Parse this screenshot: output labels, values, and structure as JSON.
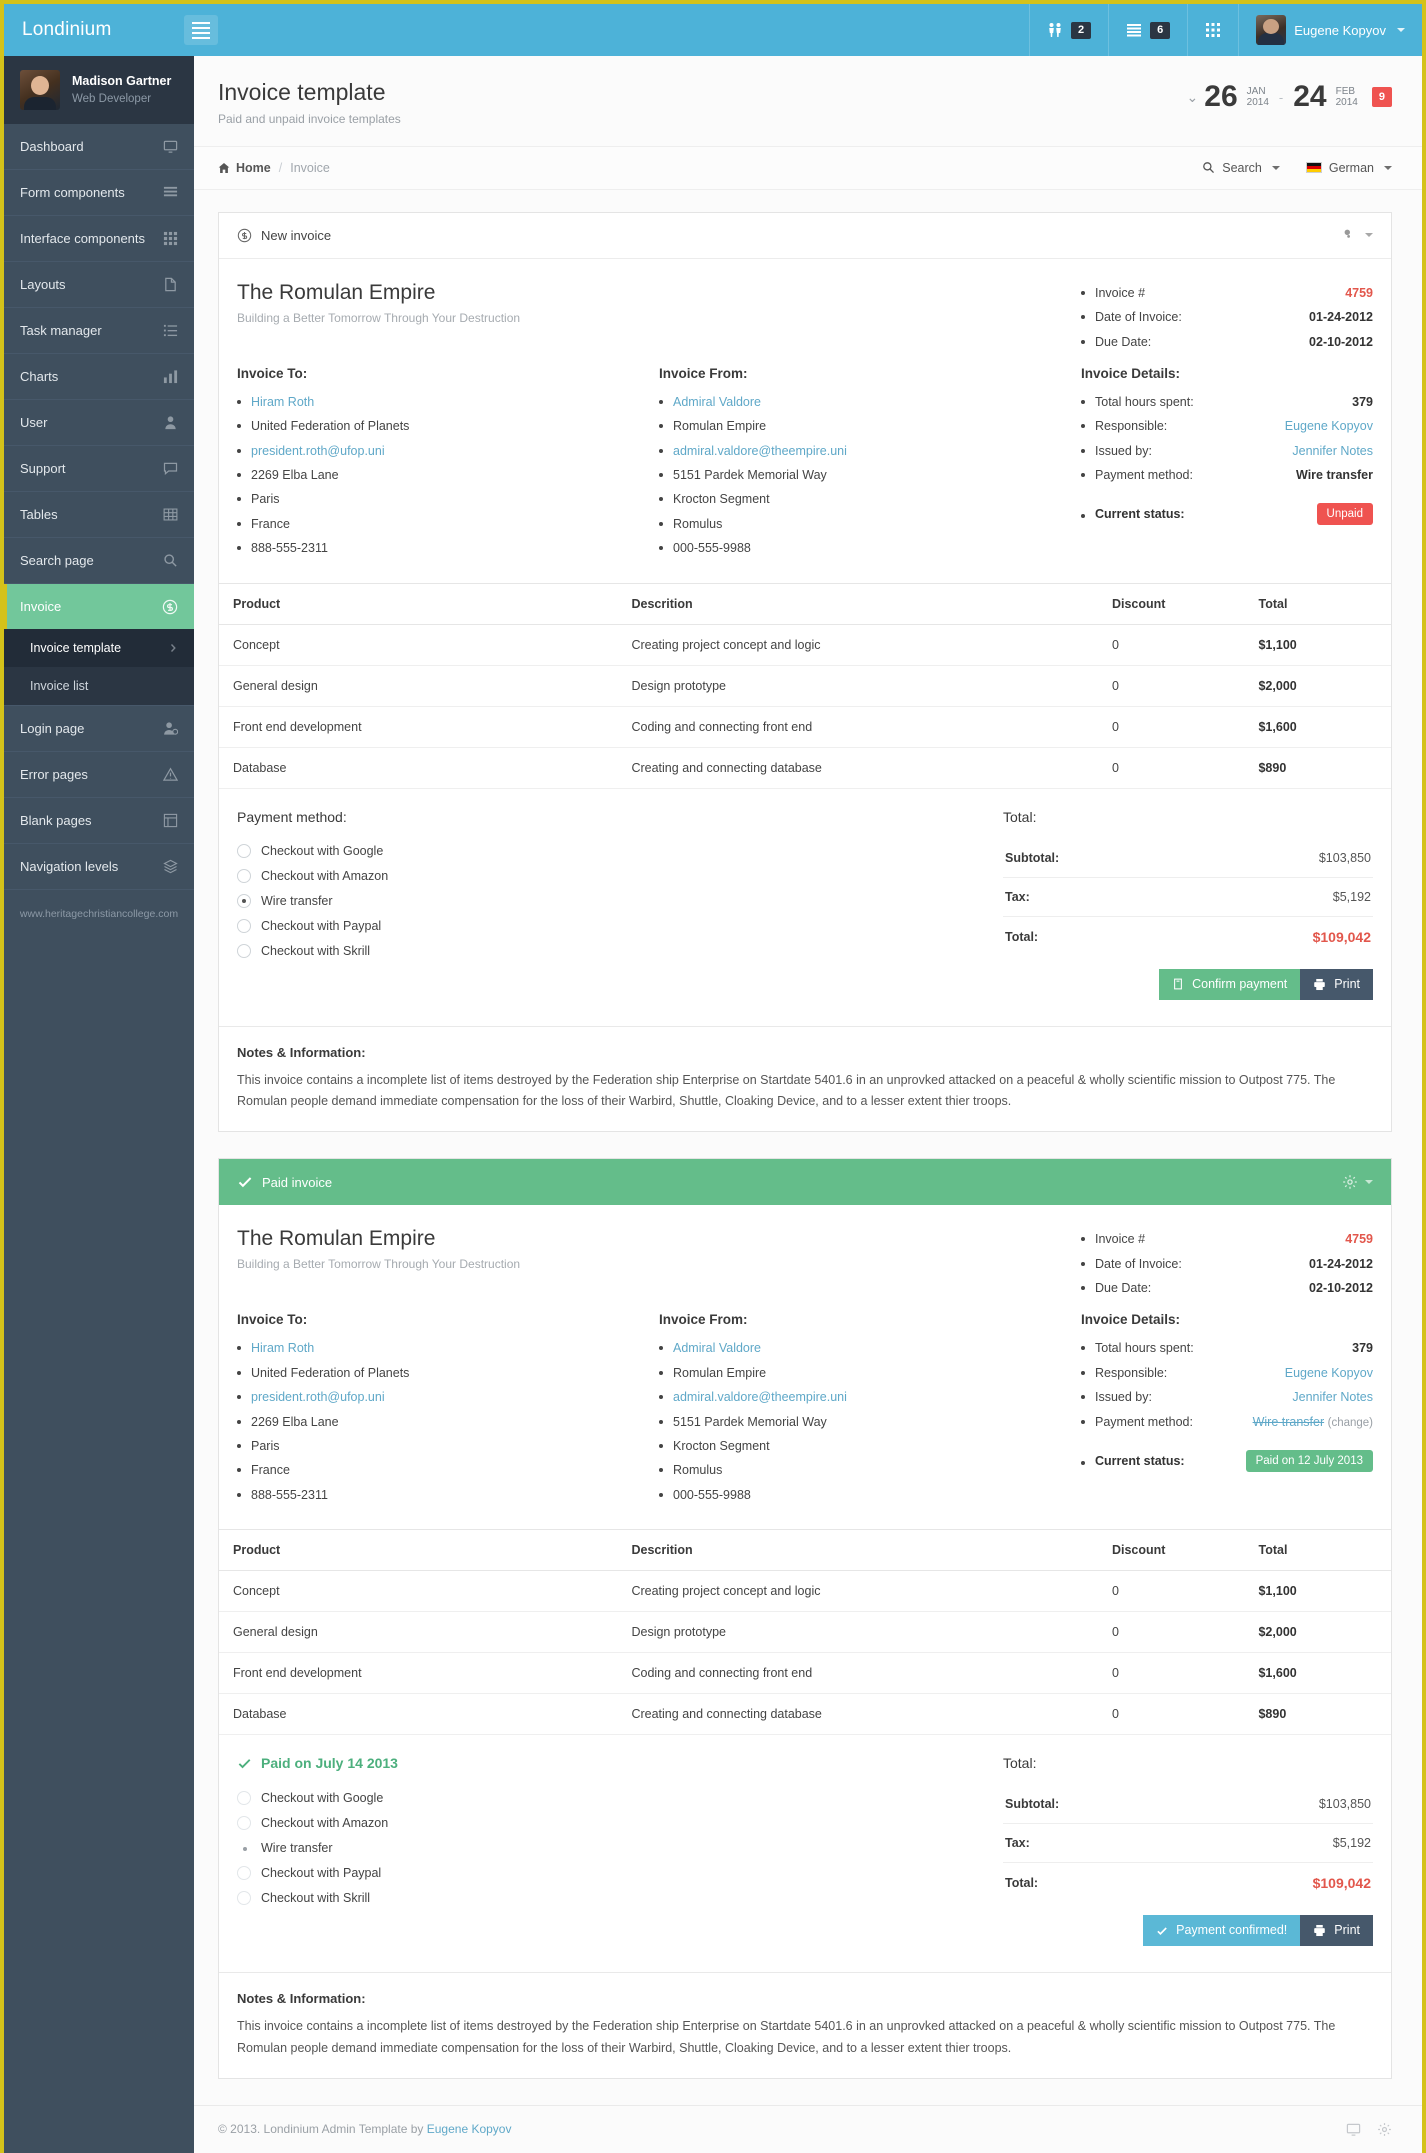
{
  "navbar": {
    "brand": "Londinium",
    "toggle_icon": "hamburger-icon",
    "items": [
      {
        "icon": "users-icon",
        "badge": "2"
      },
      {
        "icon": "lines-icon",
        "badge": "6"
      },
      {
        "icon": "grid-icon",
        "badge": ""
      }
    ],
    "user": "Eugene Kopyov"
  },
  "sidebar": {
    "profile": {
      "name": "Madison Gartner",
      "role": "Web Developer"
    },
    "items": [
      {
        "label": "Dashboard",
        "icon": "monitor-icon"
      },
      {
        "label": "Form components",
        "icon": "list-icon"
      },
      {
        "label": "Interface components",
        "icon": "grid-icon"
      },
      {
        "label": "Layouts",
        "icon": "page-icon"
      },
      {
        "label": "Task manager",
        "icon": "tasks-icon"
      },
      {
        "label": "Charts",
        "icon": "bars-icon"
      },
      {
        "label": "User",
        "icon": "user-icon"
      },
      {
        "label": "Support",
        "icon": "chat-icon"
      },
      {
        "label": "Tables",
        "icon": "table-icon"
      },
      {
        "label": "Search page",
        "icon": "search-icon"
      },
      {
        "label": "Invoice",
        "icon": "dollar-icon"
      },
      {
        "label": "Login page",
        "icon": "login-icon"
      },
      {
        "label": "Error pages",
        "icon": "warning-icon"
      },
      {
        "label": "Blank pages",
        "icon": "blank-icon"
      },
      {
        "label": "Navigation levels",
        "icon": "layers-icon"
      }
    ],
    "submenu": [
      {
        "label": "Invoice template",
        "selected": true
      },
      {
        "label": "Invoice list",
        "selected": false
      }
    ],
    "site_url": "www.heritagechristiancollege.com"
  },
  "page": {
    "title": "Invoice template",
    "subtitle": "Paid and unpaid invoice templates",
    "daterange": {
      "from_day": "26",
      "from_month": "JAN",
      "from_year": "2014",
      "to_day": "24",
      "to_month": "FEB",
      "to_year": "2014",
      "badge": "9"
    }
  },
  "breadcrumb": {
    "home": "Home",
    "separator": "/",
    "current": "Invoice",
    "search_label": "Search",
    "language_label": "German"
  },
  "invoice_unpaid": {
    "panel_title": "New invoice",
    "panel_icon": "dollar-circle-icon",
    "company": "The Romulan Empire",
    "tagline": "Building a Better Tomorrow Through Your Destruction",
    "header_meta": [
      {
        "label": "Invoice #",
        "value": "4759",
        "style": "red"
      },
      {
        "label": "Date of Invoice:",
        "value": "01-24-2012",
        "style": "bold"
      },
      {
        "label": "Due Date:",
        "value": "02-10-2012",
        "style": "bold"
      }
    ],
    "invoice_to_title": "Invoice To:",
    "invoice_to": [
      {
        "text": "Hiram Roth",
        "link": true
      },
      {
        "text": "United Federation of Planets",
        "link": false
      },
      {
        "text": "president.roth@ufop.uni",
        "link": true
      },
      {
        "text": "2269 Elba Lane",
        "link": false
      },
      {
        "text": "Paris",
        "link": false
      },
      {
        "text": "France",
        "link": false
      },
      {
        "text": "888-555-2311",
        "link": false
      }
    ],
    "invoice_from_title": "Invoice From:",
    "invoice_from": [
      {
        "text": "Admiral Valdore",
        "link": true
      },
      {
        "text": "Romulan Empire",
        "link": false
      },
      {
        "text": "admiral.valdore@theempire.uni",
        "link": true
      },
      {
        "text": "5151 Pardek Memorial Way",
        "link": false
      },
      {
        "text": "Krocton Segment",
        "link": false
      },
      {
        "text": "Romulus",
        "link": false
      },
      {
        "text": "000-555-9988",
        "link": false
      }
    ],
    "details_title": "Invoice Details:",
    "details": [
      {
        "label": "Total hours spent:",
        "value": "379",
        "style": "plain"
      },
      {
        "label": "Responsible:",
        "value": "Eugene Kopyov",
        "style": "link"
      },
      {
        "label": "Issued by:",
        "value": "Jennifer Notes",
        "style": "link"
      },
      {
        "label": "Payment method:",
        "value": "Wire transfer",
        "style": "plain"
      }
    ],
    "status_label": "Current status:",
    "status_value": "Unpaid",
    "table": {
      "headers": [
        "Product",
        "Descrition",
        "Discount",
        "Total"
      ],
      "rows": [
        [
          "Concept",
          "Creating project concept and logic",
          "0",
          "$1,100"
        ],
        [
          "General design",
          "Design prototype",
          "0",
          "$2,000"
        ],
        [
          "Front end development",
          "Coding and connecting front end",
          "0",
          "$1,600"
        ],
        [
          "Database",
          "Creating and connecting database",
          "0",
          "$890"
        ]
      ]
    },
    "payment_title": "Payment method:",
    "payment_options": [
      {
        "label": "Checkout with Google",
        "selected": false
      },
      {
        "label": "Checkout with Amazon",
        "selected": false
      },
      {
        "label": "Wire transfer",
        "selected": true
      },
      {
        "label": "Checkout with Paypal",
        "selected": false
      },
      {
        "label": "Checkout with Skrill",
        "selected": false
      }
    ],
    "totals_title": "Total:",
    "totals": [
      {
        "label": "Subtotal:",
        "value": "$103,850",
        "grand": false
      },
      {
        "label": "Tax:",
        "value": "$5,192",
        "grand": false
      },
      {
        "label": "Total:",
        "value": "$109,042",
        "grand": true
      }
    ],
    "confirm_button": "Confirm payment",
    "print_button": "Print",
    "notes_title": "Notes & Information:",
    "notes_body": "This invoice contains a incomplete list of items destroyed by the Federation ship Enterprise on Startdate 5401.6 in an unprovked attacked on a peaceful & wholly scientific mission to Outpost 775. The Romulan people demand immediate compensation for the loss of their Warbird, Shuttle, Cloaking Device, and to a lesser extent thier troops."
  },
  "invoice_paid": {
    "panel_title": "Paid invoice",
    "panel_icon": "check-icon",
    "company": "The Romulan Empire",
    "tagline": "Building a Better Tomorrow Through Your Destruction",
    "header_meta": [
      {
        "label": "Invoice #",
        "value": "4759",
        "style": "red"
      },
      {
        "label": "Date of Invoice:",
        "value": "01-24-2012",
        "style": "bold"
      },
      {
        "label": "Due Date:",
        "value": "02-10-2012",
        "style": "bold"
      }
    ],
    "invoice_to_title": "Invoice To:",
    "invoice_to": [
      {
        "text": "Hiram Roth",
        "link": true
      },
      {
        "text": "United Federation of Planets",
        "link": false
      },
      {
        "text": "president.roth@ufop.uni",
        "link": true
      },
      {
        "text": "2269 Elba Lane",
        "link": false
      },
      {
        "text": "Paris",
        "link": false
      },
      {
        "text": "France",
        "link": false
      },
      {
        "text": "888-555-2311",
        "link": false
      }
    ],
    "invoice_from_title": "Invoice From:",
    "invoice_from": [
      {
        "text": "Admiral Valdore",
        "link": true
      },
      {
        "text": "Romulan Empire",
        "link": false
      },
      {
        "text": "admiral.valdore@theempire.uni",
        "link": true
      },
      {
        "text": "5151 Pardek Memorial Way",
        "link": false
      },
      {
        "text": "Krocton Segment",
        "link": false
      },
      {
        "text": "Romulus",
        "link": false
      },
      {
        "text": "000-555-9988",
        "link": false
      }
    ],
    "details_title": "Invoice Details:",
    "details": [
      {
        "label": "Total hours spent:",
        "value": "379",
        "style": "plain"
      },
      {
        "label": "Responsible:",
        "value": "Eugene Kopyov",
        "style": "link"
      },
      {
        "label": "Issued by:",
        "value": "Jennifer Notes",
        "style": "link"
      }
    ],
    "payment_method_label": "Payment method:",
    "payment_method_value": "Wire transfer",
    "payment_method_change": "(change)",
    "status_label": "Current status:",
    "status_value": "Paid on 12 July 2013",
    "table": {
      "headers": [
        "Product",
        "Descrition",
        "Discount",
        "Total"
      ],
      "rows": [
        [
          "Concept",
          "Creating project concept and logic",
          "0",
          "$1,100"
        ],
        [
          "General design",
          "Design prototype",
          "0",
          "$2,000"
        ],
        [
          "Front end development",
          "Coding and connecting front end",
          "0",
          "$1,600"
        ],
        [
          "Database",
          "Creating and connecting database",
          "0",
          "$890"
        ]
      ]
    },
    "payment_title": "Paid on July 14 2013",
    "payment_options": [
      {
        "label": "Checkout with Google",
        "selected": false
      },
      {
        "label": "Checkout with Amazon",
        "selected": false
      },
      {
        "label": "Wire transfer",
        "selected": true
      },
      {
        "label": "Checkout with Paypal",
        "selected": false
      },
      {
        "label": "Checkout with Skrill",
        "selected": false
      }
    ],
    "totals_title": "Total:",
    "totals": [
      {
        "label": "Subtotal:",
        "value": "$103,850",
        "grand": false
      },
      {
        "label": "Tax:",
        "value": "$5,192",
        "grand": false
      },
      {
        "label": "Total:",
        "value": "$109,042",
        "grand": true
      }
    ],
    "confirm_button": "Payment confirmed!",
    "print_button": "Print",
    "notes_title": "Notes & Information:",
    "notes_body": "This invoice contains a incomplete list of items destroyed by the Federation ship Enterprise on Startdate 5401.6 in an unprovked attacked on a peaceful & wholly scientific mission to Outpost 775. The Romulan people demand immediate compensation for the loss of their Warbird, Shuttle, Cloaking Device, and to a lesser extent thier troops."
  },
  "footer": {
    "copyright_prefix": "© 2013. Londinium Admin Template by ",
    "author": "Eugene Kopyov"
  },
  "colors": {
    "navbar": "#4db2d8",
    "sidebar": "#3f4f5e",
    "active_green": "#72c79b",
    "accent_red": "#ef5350",
    "link_blue": "#5fa8c8",
    "outer_border": "#d4c21a"
  }
}
